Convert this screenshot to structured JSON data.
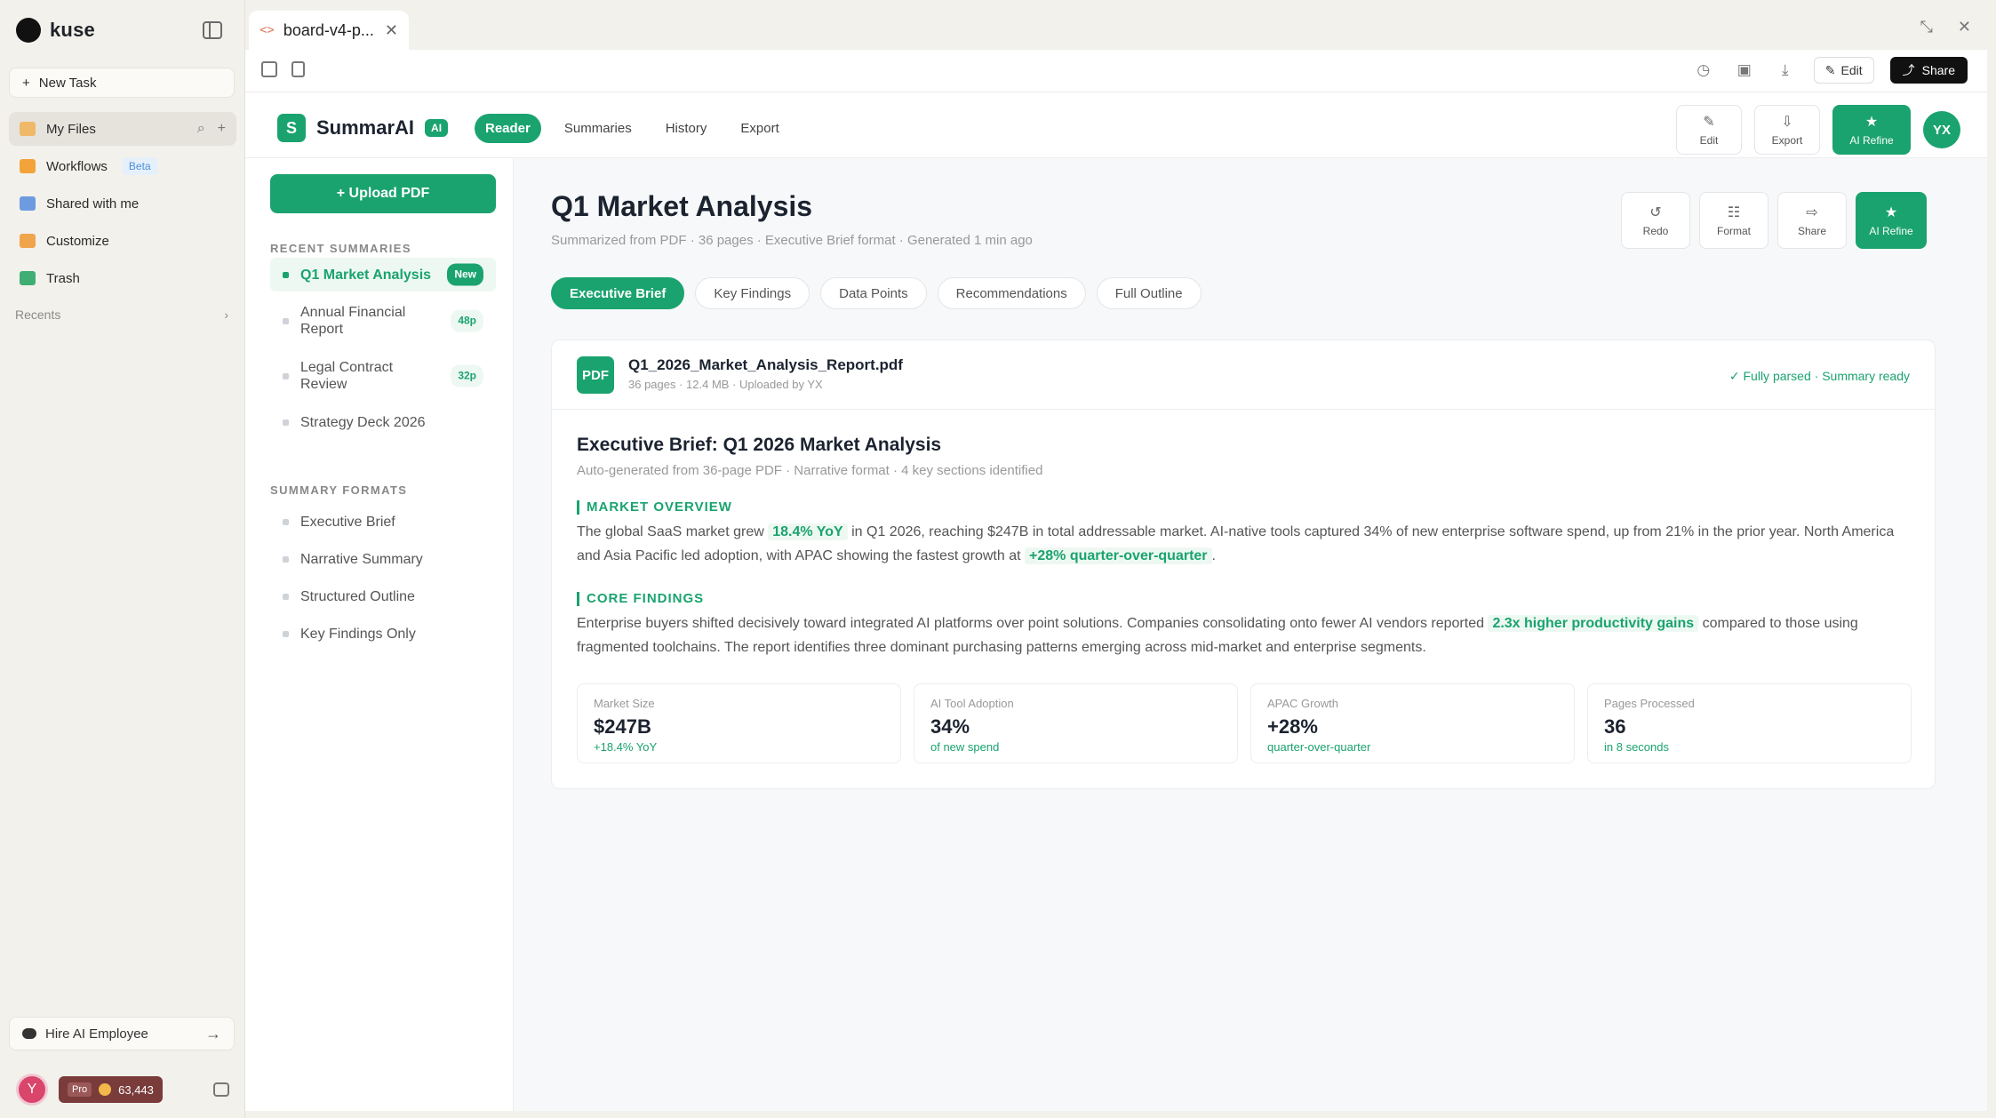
{
  "sidebar": {
    "brand": "kuse",
    "new_task": "New Task",
    "items": [
      {
        "label": "My Files",
        "icon": "folder-icon"
      },
      {
        "label": "Workflows",
        "icon": "workflow-icon",
        "badge": "Beta"
      },
      {
        "label": "Shared with me",
        "icon": "shared-folder-icon"
      },
      {
        "label": "Customize",
        "icon": "puzzle-icon"
      },
      {
        "label": "Trash",
        "icon": "trash-icon"
      }
    ],
    "recents": "Recents",
    "hire_ai": "Hire AI Employee",
    "user_initial": "Y",
    "plan": "Pro",
    "credits": "63,443"
  },
  "window": {
    "tab_title": "board-v4-p...",
    "edit_label": "Edit",
    "share_label": "Share"
  },
  "app": {
    "name": "SummarAI",
    "badge": "AI",
    "nav": [
      "Reader",
      "Summaries",
      "History",
      "Export"
    ],
    "header_actions": {
      "edit": "Edit",
      "export": "Export",
      "refine": "AI Refine"
    },
    "avatar": "YX",
    "upload": "+ Upload PDF",
    "recent_title": "RECENT SUMMARIES",
    "recent": [
      {
        "label": "Q1 Market Analysis",
        "pill": "New"
      },
      {
        "label": "Annual Financial Report",
        "pill": "48p"
      },
      {
        "label": "Legal Contract Review",
        "pill": "32p"
      },
      {
        "label": "Strategy Deck 2026",
        "pill": ""
      }
    ],
    "formats_title": "SUMMARY FORMATS",
    "formats": [
      "Executive Brief",
      "Narrative Summary",
      "Structured Outline",
      "Key Findings Only"
    ]
  },
  "main": {
    "title": "Q1 Market Analysis",
    "meta": "Summarized from PDF · 36 pages · Executive Brief format · Generated 1 min ago",
    "actions": {
      "redo": "Redo",
      "format": "Format",
      "share": "Share",
      "refine": "AI Refine"
    },
    "tabs": [
      "Executive Brief",
      "Key Findings",
      "Data Points",
      "Recommendations",
      "Full Outline"
    ],
    "file": {
      "badge": "PDF",
      "name": "Q1_2026_Market_Analysis_Report.pdf",
      "meta": "36 pages · 12.4 MB · Uploaded by YX",
      "status": "✓  Fully parsed · Summary ready"
    },
    "brief_title": "Executive Brief: Q1 2026 Market Analysis",
    "brief_meta": "Auto-generated from 36-page PDF · Narrative format · 4 key sections identified",
    "s1_head": "MARKET OVERVIEW",
    "s1_a": "The global SaaS market grew ",
    "s1_h1": "18.4% YoY",
    "s1_b": " in Q1 2026, reaching $247B in total addressable market. AI-native tools captured 34% of new enterprise software spend, up from 21% in the prior year. North America and Asia Pacific led adoption, with APAC showing the fastest growth at ",
    "s1_h2": "+28% quarter-over-quarter",
    "s1_c": ".",
    "s2_head": "CORE FINDINGS",
    "s2_a": "Enterprise buyers shifted decisively toward integrated AI platforms over point solutions. Companies consolidating onto fewer AI vendors reported ",
    "s2_h1": "2.3x higher productivity gains",
    "s2_b": " compared to those using fragmented toolchains. The report identifies three dominant purchasing patterns emerging across mid-market and enterprise segments.",
    "stats": [
      {
        "label": "Market Size",
        "value": "$247B",
        "sub": "+18.4% YoY"
      },
      {
        "label": "AI Tool Adoption",
        "value": "34%",
        "sub": "of new spend"
      },
      {
        "label": "APAC Growth",
        "value": "+28%",
        "sub": "quarter-over-quarter"
      },
      {
        "label": "Pages Processed",
        "value": "36",
        "sub": "in 8 seconds"
      }
    ]
  },
  "colors": {
    "accent": "#1aa36f",
    "sidebar_bg": "#f3f1ec"
  }
}
